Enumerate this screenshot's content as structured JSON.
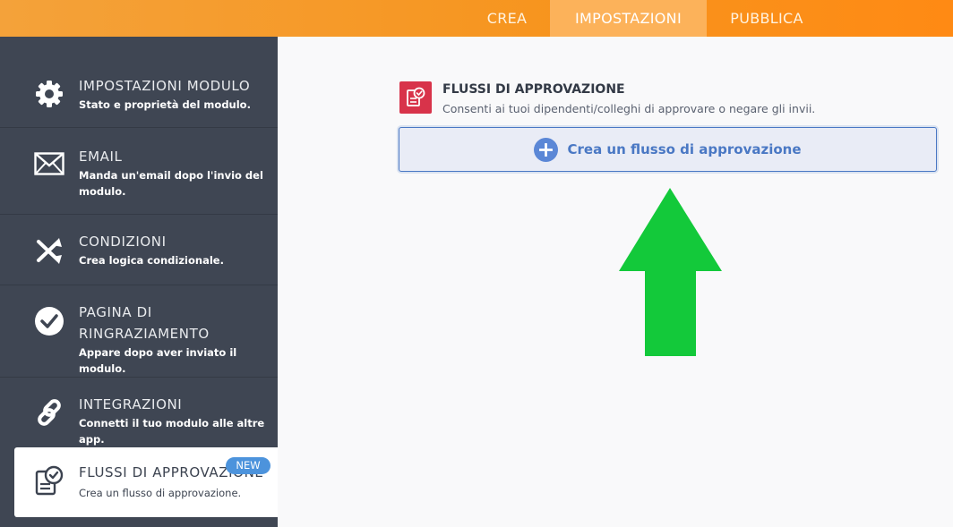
{
  "topbar": {
    "tabs": [
      {
        "label": "CREA"
      },
      {
        "label": "IMPOSTAZIONI"
      },
      {
        "label": "PUBBLICA"
      }
    ]
  },
  "sidebar": {
    "items": [
      {
        "icon": "gear-icon",
        "title": "IMPOSTAZIONI MODULO",
        "desc": "Stato e proprietà del modulo."
      },
      {
        "icon": "envelope-icon",
        "title": "EMAIL",
        "desc": "Manda un'email dopo l'invio del modulo."
      },
      {
        "icon": "shuffle-icon",
        "title": "CONDIZIONI",
        "desc": "Crea logica condizionale."
      },
      {
        "icon": "check-circle-icon",
        "title": "PAGINA DI RINGRAZIAMENTO",
        "desc": "Appare dopo aver inviato il modulo."
      },
      {
        "icon": "link-icon",
        "title": "INTEGRAZIONI",
        "desc": "Connetti il tuo modulo alle altre app."
      }
    ],
    "active": {
      "icon": "approval-document-icon",
      "title": "FLUSSI DI APPROVAZIONE",
      "desc": "Crea un flusso di approvazione.",
      "badge": "NEW"
    }
  },
  "main": {
    "section_icon": "approval-document-icon",
    "section_title": "FLUSSI DI APPROVAZIONE",
    "section_desc": "Consenti ai tuoi dipendenti/colleghi di approvare o negare gli invii.",
    "create_button_label": "Crea un flusso di approvazione"
  },
  "colors": {
    "topbar_orange": "#f7941d",
    "sidebar_bg": "#3f4653",
    "accent_blue": "#4a78c4",
    "badge_blue": "#4c93dc",
    "icon_red": "#d8334a",
    "arrow_green": "#13c93a"
  }
}
